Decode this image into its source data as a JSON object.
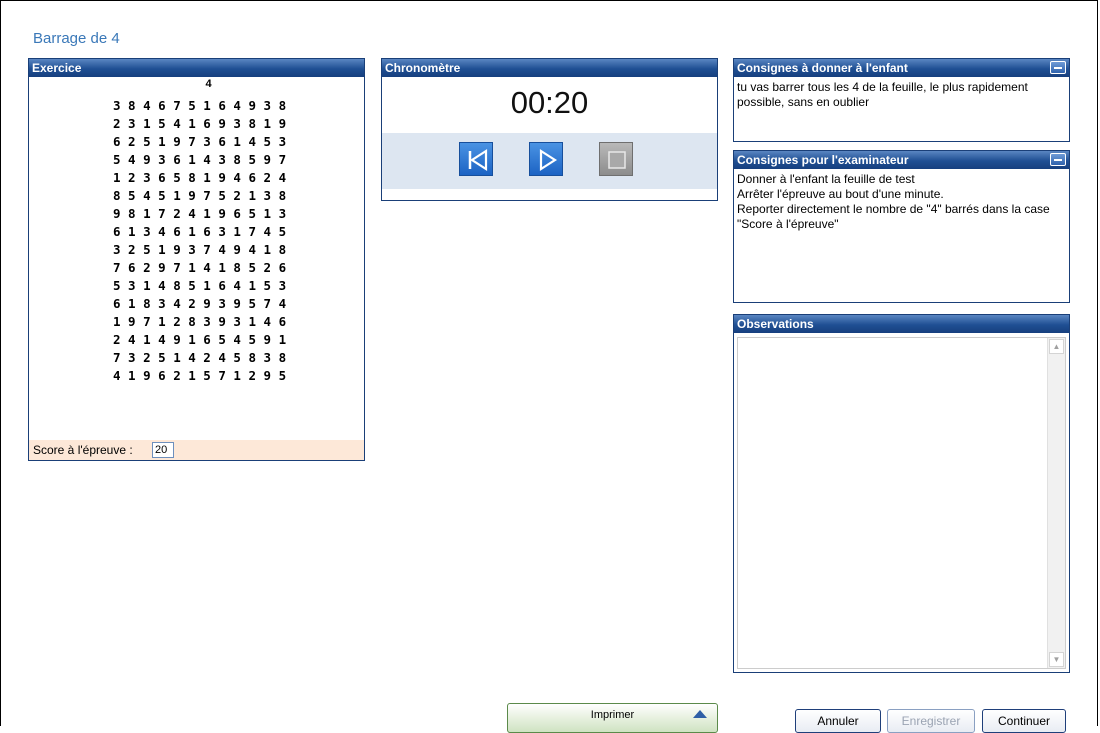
{
  "page": {
    "title": "Barrage de 4"
  },
  "exercice": {
    "header": "Exercice",
    "target_digit": "4",
    "grid_rows": [
      "3 8 4 6 7 5 1 6 4 9 3 8",
      "2 3 1 5 4 1 6 9 3 8 1 9",
      "6 2 5 1 9 7 3 6 1 4 5 3",
      "5 4 9 3 6 1 4 3 8 5 9 7",
      "1 2 3 6 5 8 1 9 4 6 2 4",
      "8 5 4 5 1 9 7 5 2 1 3 8",
      "9 8 1 7 2 4 1 9 6 5 1 3",
      "6 1 3 4 6 1 6 3 1 7 4 5",
      "3 2 5 1 9 3 7 4 9 4 1 8",
      "7 6 2 9 7 1 4 1 8 5 2 6",
      "5 3 1 4 8 5 1 6 4 1 5 3",
      "6 1 8 3 4 2 9 3 9 5 7 4",
      "1 9 7 1 2 8 3 9 3 1 4 6",
      "2 4 1 4 9 1 6 5 4 5 9 1",
      "7 3 2 5 1 4 2 4 5 8 3 8",
      "4 1 9 6 2 1 5 7 1 2 9 5"
    ],
    "score_label": "Score à l'épreuve :",
    "score_value": "20"
  },
  "chrono": {
    "header": "Chronomètre",
    "time": "00:20",
    "icons": [
      "rewind-icon",
      "play-icon",
      "stop-icon"
    ]
  },
  "consignes_enfant": {
    "header": "Consignes à donner à l'enfant",
    "text": "tu vas barrer tous les 4 de la feuille, le plus rapidement possible, sans en oublier"
  },
  "consignes_examinateur": {
    "header": "Consignes pour l'examinateur",
    "lines": [
      "Donner à l'enfant la feuille de test",
      "Arrêter l'épreuve au bout d'une minute.",
      "Reporter directement le nombre de \"4\" barrés dans la case \"Score à l'épreuve\""
    ]
  },
  "observations": {
    "header": "Observations",
    "value": ""
  },
  "footer": {
    "print_label": "Imprimer",
    "annuler_label": "Annuler",
    "enregistrer_label": "Enregistrer",
    "continuer_label": "Continuer"
  },
  "colors": {
    "title_blue": "#3a78b8",
    "panel_header": "#1f4f93",
    "score_bar_bg": "#fde8d8",
    "chrono_ctrl_bg": "#dde6f1",
    "button_blue": "#1c63c4"
  }
}
